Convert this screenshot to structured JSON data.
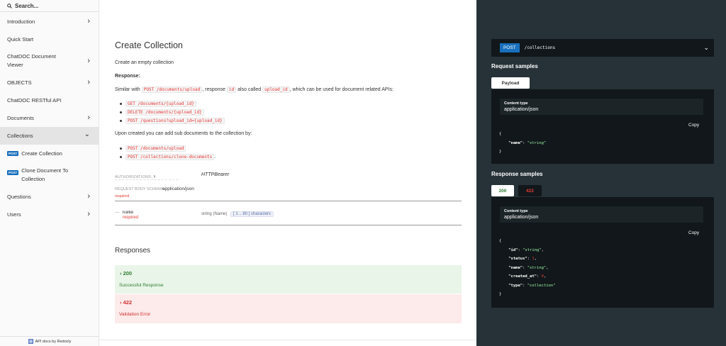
{
  "sidebar": {
    "search_placeholder": "Search...",
    "items": [
      {
        "label": "Introduction",
        "chevron": "›"
      },
      {
        "label": "Quick Start",
        "chevron": ""
      },
      {
        "label": "ChatDOC Document Viewer",
        "chevron": "›"
      },
      {
        "label": "OBJECTS",
        "chevron": "›"
      },
      {
        "label": "ChatDOC RESTful API",
        "chevron": ""
      },
      {
        "label": "Documents",
        "chevron": "›"
      },
      {
        "label": "Collections",
        "chevron": "⌄"
      },
      {
        "label": "Questions",
        "chevron": "›"
      },
      {
        "label": "Users",
        "chevron": "›"
      }
    ],
    "sub_items": [
      {
        "method": "POST",
        "label": "Create Collection"
      },
      {
        "method": "POST",
        "label": "Clone Document To Collection"
      }
    ],
    "footer": "API docs by Redocly"
  },
  "main": {
    "title": "Create Collection",
    "description": "Create an empty collection",
    "response_label": "Response:",
    "similar_pre": "Similar with",
    "similar_code1": "POST /documents/upload",
    "similar_mid": ", response",
    "similar_code2": "id",
    "similar_mid2": "also called",
    "similar_code3": "upload_id",
    "similar_post": ", which can be used for document related APIs:",
    "api_list": [
      "GET /documents/{upload_id}",
      "DELETE /documents/{upload_id}",
      "POST /questions?upload_id={upload_id}"
    ],
    "upon_created": "Upon created you can add sub documents to the collection by:",
    "sub_doc_list": [
      "POST /documents/upload",
      "POST /collections/clone-documents"
    ],
    "sub_doc_list_suffix": ".",
    "authorizations_label": "AUTHORIZATIONS:",
    "authorizations_value": "HTTPBearer",
    "schema_label": "REQUEST BODY SCHEMA:",
    "schema_value": "application/json",
    "required_label": "required",
    "field": {
      "name": "name",
      "required": "required",
      "type": "string (Name)",
      "range": "[ 1 .. 80 ] characters"
    },
    "responses_title": "Responses",
    "responses": [
      {
        "code": "200",
        "desc": "Successful Response"
      },
      {
        "code": "422",
        "desc": "Validation Error"
      }
    ]
  },
  "right": {
    "method": "POST",
    "path": "/collections",
    "request_title": "Request samples",
    "request_tab": "Payload",
    "content_type_label": "Content type",
    "content_type_value": "application/json",
    "copy_label": "Copy",
    "request_json": {
      "brace_open": "{",
      "key": "\"name\"",
      "value": "\"string\"",
      "brace_close": "}"
    },
    "response_title": "Response samples",
    "response_tabs": [
      "200",
      "422"
    ],
    "response_json": {
      "brace_open": "{",
      "lines": [
        {
          "key": "\"id\"",
          "value": "\"string\"",
          "kind": "s"
        },
        {
          "key": "\"status\"",
          "value": "1",
          "kind": "n"
        },
        {
          "key": "\"name\"",
          "value": "\"string\"",
          "kind": "s"
        },
        {
          "key": "\"created_at\"",
          "value": "0",
          "kind": "n"
        },
        {
          "key": "\"type\"",
          "value": "\"collection\"",
          "kind": "s"
        }
      ],
      "brace_close": "}"
    }
  },
  "colors": {
    "accent_post": "#186fbd",
    "success": "#2e7d32",
    "error": "#d32f2f",
    "right_panel_bg": "#263238"
  }
}
